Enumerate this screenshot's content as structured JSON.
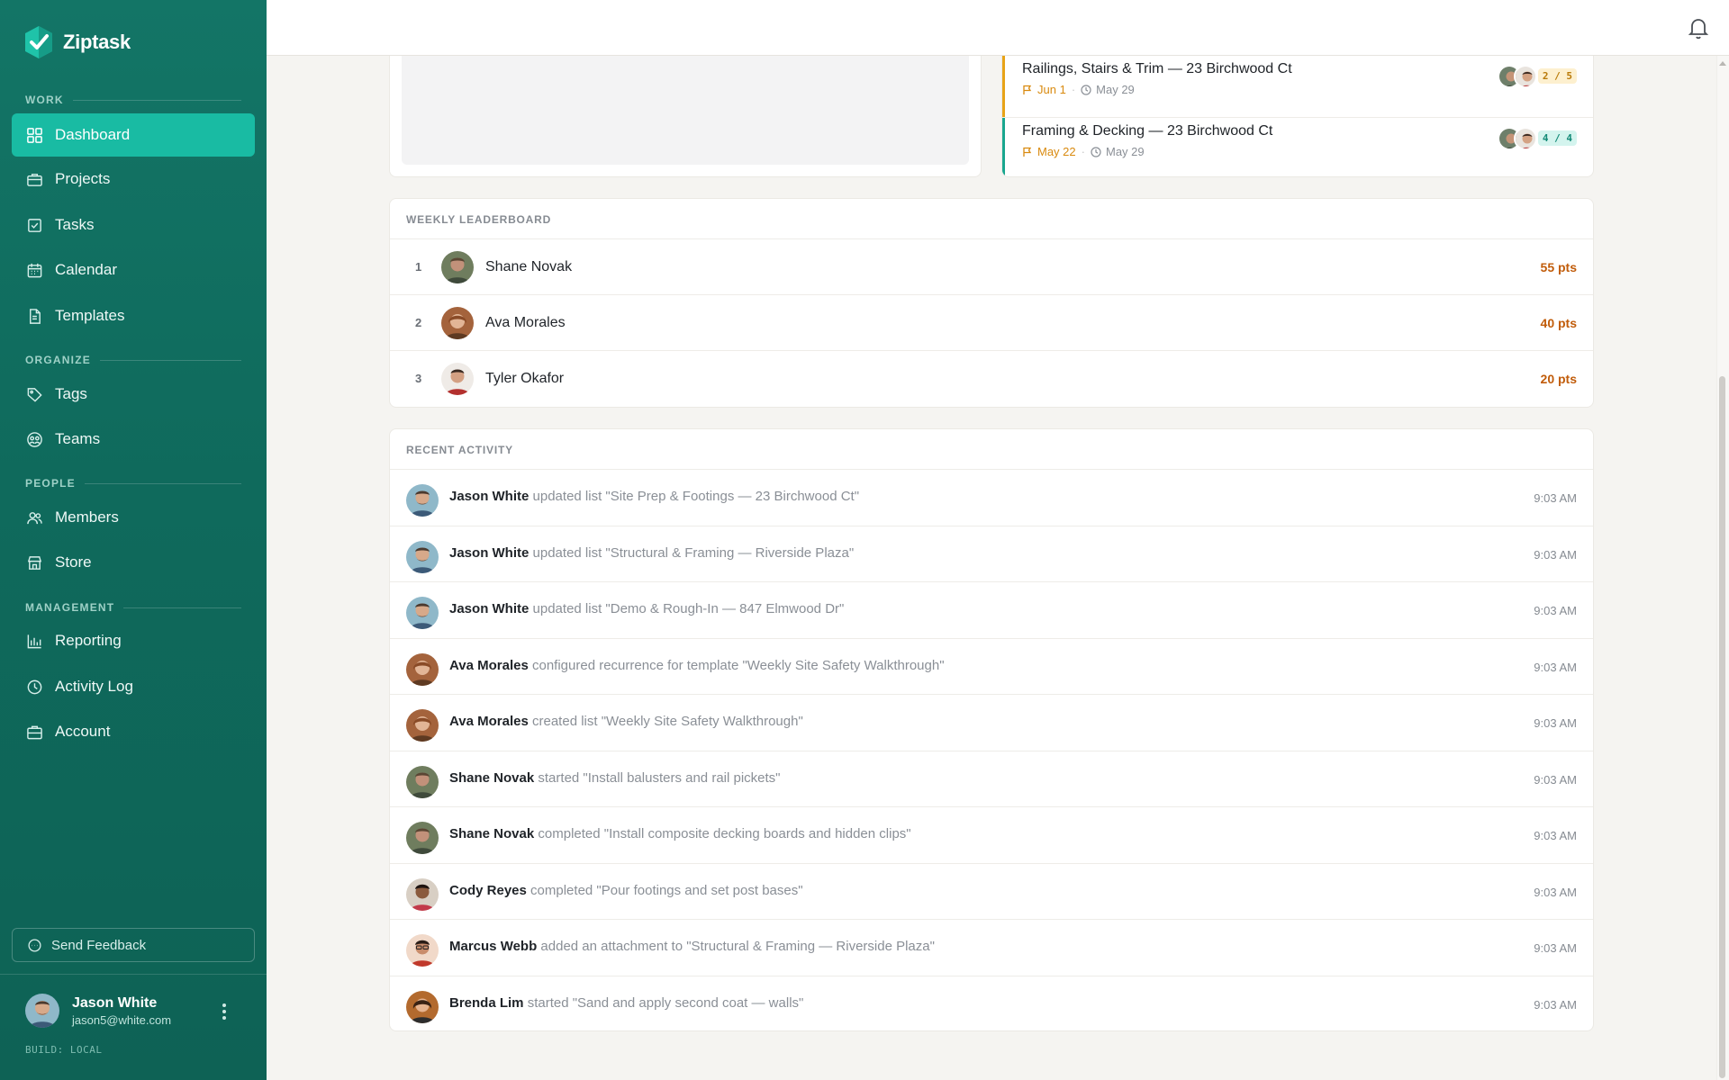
{
  "app": {
    "name": "Ziptask"
  },
  "colors": {
    "sidebar": "#137566",
    "accent": "#19bba3",
    "amber": "#d98a0f",
    "points": "#c15c0a"
  },
  "sidebar": {
    "sections": [
      {
        "label": "WORK"
      },
      {
        "label": "ORGANIZE"
      },
      {
        "label": "PEOPLE"
      },
      {
        "label": "MANAGEMENT"
      }
    ],
    "items": [
      {
        "label": "Dashboard",
        "icon": "dashboard-icon",
        "active": true
      },
      {
        "label": "Projects",
        "icon": "briefcase-icon"
      },
      {
        "label": "Tasks",
        "icon": "checkbox-icon"
      },
      {
        "label": "Calendar",
        "icon": "calendar-icon"
      },
      {
        "label": "Templates",
        "icon": "document-icon"
      },
      {
        "label": "Tags",
        "icon": "tag-icon"
      },
      {
        "label": "Teams",
        "icon": "team-icon"
      },
      {
        "label": "Members",
        "icon": "members-icon"
      },
      {
        "label": "Store",
        "icon": "store-icon"
      },
      {
        "label": "Reporting",
        "icon": "bar-chart-icon"
      },
      {
        "label": "Activity Log",
        "icon": "clock-icon"
      },
      {
        "label": "Account",
        "icon": "account-icon"
      }
    ],
    "feedback_label": "Send Feedback",
    "user": {
      "name": "Jason White",
      "email": "jason5@white.com"
    },
    "build": "BUILD: LOCAL"
  },
  "tasks": [
    {
      "title": "Railings, Stairs & Trim — 23 Birchwood Ct",
      "due": "Jun 1",
      "created": "May 29",
      "progress": "2 / 5",
      "status_color": "#e8a317"
    },
    {
      "title": "Framing & Decking — 23 Birchwood Ct",
      "due": "May 22",
      "created": "May 29",
      "progress": "4 / 4",
      "status_color": "#19a68f"
    }
  ],
  "leaderboard": {
    "title": "WEEKLY LEADERBOARD",
    "rows": [
      {
        "rank": "1",
        "name": "Shane Novak",
        "points": "55 pts"
      },
      {
        "rank": "2",
        "name": "Ava Morales",
        "points": "40 pts"
      },
      {
        "rank": "3",
        "name": "Tyler Okafor",
        "points": "20 pts"
      }
    ]
  },
  "activity": {
    "title": "RECENT ACTIVITY",
    "rows": [
      {
        "user": "Jason White",
        "action": "updated list \"Site Prep & Footings — 23 Birchwood Ct\"",
        "time": "9:03 AM"
      },
      {
        "user": "Jason White",
        "action": "updated list \"Structural & Framing — Riverside Plaza\"",
        "time": "9:03 AM"
      },
      {
        "user": "Jason White",
        "action": "updated list \"Demo & Rough-In — 847 Elmwood Dr\"",
        "time": "9:03 AM"
      },
      {
        "user": "Ava Morales",
        "action": "configured recurrence for template \"Weekly Site Safety Walkthrough\"",
        "time": "9:03 AM"
      },
      {
        "user": "Ava Morales",
        "action": "created list \"Weekly Site Safety Walkthrough\"",
        "time": "9:03 AM"
      },
      {
        "user": "Shane Novak",
        "action": "started \"Install balusters and rail pickets\"",
        "time": "9:03 AM"
      },
      {
        "user": "Shane Novak",
        "action": "completed \"Install composite decking boards and hidden clips\"",
        "time": "9:03 AM"
      },
      {
        "user": "Cody Reyes",
        "action": "completed \"Pour footings and set post bases\"",
        "time": "9:03 AM"
      },
      {
        "user": "Marcus Webb",
        "action": "added an attachment to \"Structural & Framing — Riverside Plaza\"",
        "time": "9:03 AM"
      },
      {
        "user": "Brenda Lim",
        "action": "started \"Sand and apply second coat — walls\"",
        "time": "9:03 AM"
      }
    ]
  }
}
